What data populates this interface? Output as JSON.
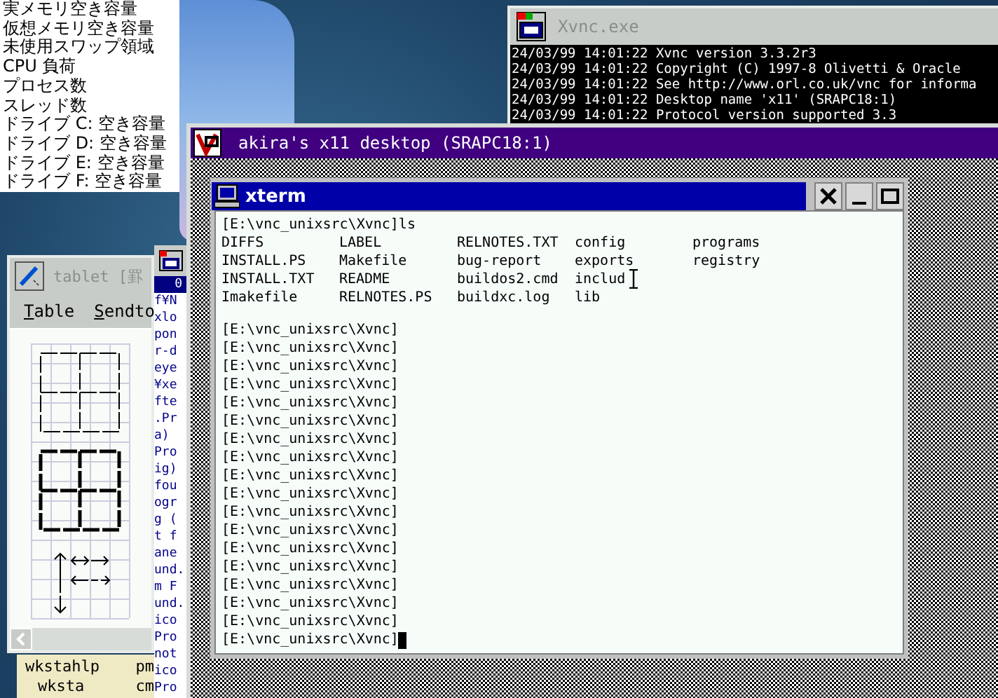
{
  "system_monitor": {
    "labels": [
      "実メモリ空き容量",
      "仮想メモリ空き容量",
      "未使用スワップ領域",
      "CPU 負荷",
      "プロセス数",
      "スレッド数",
      "ドライブ C: 空き容量",
      "ドライブ D: 空き容量",
      "ドライブ E: 空き容量",
      "ドライブ F: 空き容量"
    ]
  },
  "xvnc_window": {
    "title": "Xvnc.exe",
    "active": false,
    "log_lines": [
      "24/03/99 14:01:22 Xvnc version 3.3.2r3",
      "24/03/99 14:01:22 Copyright (C) 1997-8 Olivetti & Oracle",
      "24/03/99 14:01:22 See http://www.orl.co.uk/vnc for informa",
      "24/03/99 14:01:22 Desktop name 'x11' (SRAPC18:1)",
      "24/03/99 14:01:22 Protocol version supported 3.3"
    ]
  },
  "vnc_viewer": {
    "title": "akira's x11 desktop (SRAPC18:1)",
    "active": true
  },
  "xterm": {
    "title": "xterm",
    "active": true,
    "command_line": "[E:\\vnc_unixsrc\\Xvnc]ls",
    "ls_rows": [
      [
        "DIFFS",
        "LABEL",
        "RELNOTES.TXT",
        "config",
        "programs"
      ],
      [
        "INSTALL.PS",
        "Makefile",
        "bug-report",
        "exports",
        "registry"
      ],
      [
        "INSTALL.TXT",
        "README",
        "buildos2.cmd",
        "includ"
      ],
      [
        "Imakefile",
        "RELNOTES.PS",
        "buildxc.log",
        "lib"
      ]
    ],
    "prompt_lines": [
      "[E:\\vnc_unixsrc\\Xvnc]",
      "[E:\\vnc_unixsrc\\Xvnc]",
      "[E:\\vnc_unixsrc\\Xvnc]",
      "[E:\\vnc_unixsrc\\Xvnc]",
      "[E:\\vnc_unixsrc\\Xvnc]",
      "[E:\\vnc_unixsrc\\Xvnc]",
      "[E:\\vnc_unixsrc\\Xvnc]",
      "[E:\\vnc_unixsrc\\Xvnc]",
      "[E:\\vnc_unixsrc\\Xvnc]",
      "[E:\\vnc_unixsrc\\Xvnc]",
      "[E:\\vnc_unixsrc\\Xvnc]",
      "[E:\\vnc_unixsrc\\Xvnc]",
      "[E:\\vnc_unixsrc\\Xvnc]",
      "[E:\\vnc_unixsrc\\Xvnc]",
      "[E:\\vnc_unixsrc\\Xvnc]",
      "[E:\\vnc_unixsrc\\Xvnc]",
      "[E:\\vnc_unixsrc\\Xvnc]"
    ],
    "current_prompt": "[E:\\vnc_unixsrc\\Xvnc]",
    "cursor": true
  },
  "tablet_window": {
    "title": "tablet [罫",
    "active": false,
    "menu": [
      "Table",
      "Sendto"
    ]
  },
  "text_strip": {
    "selected_line": "0",
    "lines": [
      "f¥N",
      "xlo",
      "pon",
      "r-d",
      "eye",
      "¥xe",
      "fte",
      ".Pr",
      "a)",
      "Pro",
      "ig)",
      "fou",
      "ogr",
      "g (",
      "t f",
      "ane",
      "und.",
      "m F",
      "und.",
      "ico",
      "Pro",
      "not",
      "ico",
      "Pro"
    ]
  },
  "file_panel": {
    "column_1": [
      "wkstahlp",
      "wksta"
    ],
    "column_2": [
      "pm",
      "cm"
    ]
  }
}
